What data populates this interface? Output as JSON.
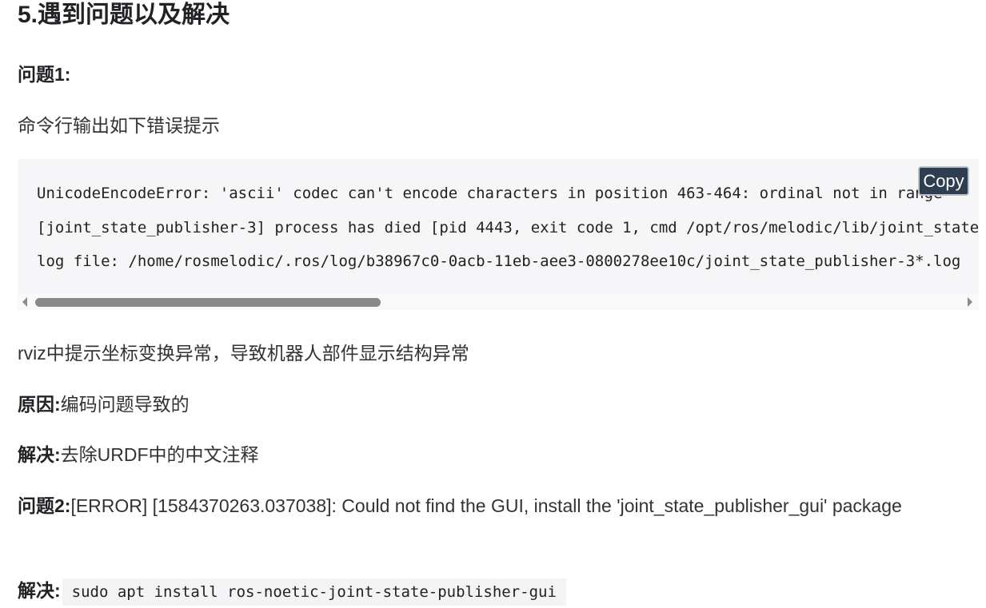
{
  "section_title": "5.遇到问题以及解决",
  "problem1": {
    "heading": "问题1:",
    "desc": "命令行输出如下错误提示",
    "code_lines": [
      "UnicodeEncodeError: 'ascii' codec can't encode characters in position 463-464: ordinal not in range",
      "[joint_state_publisher-3] process has died [pid 4443, exit code 1, cmd /opt/ros/melodic/lib/joint_state_publisher",
      "log file: /home/rosmelodic/.ros/log/b38967c0-0acb-11eb-aee3-0800278ee10c/joint_state_publisher-3*.log"
    ],
    "copy_label": "Copy",
    "rviz_note": "rviz中提示坐标变换异常，导致机器人部件显示结构异常",
    "cause_label": "原因:",
    "cause_text": "编码问题导致的",
    "solution_label": "解决:",
    "solution_text": "去除URDF中的中文注释"
  },
  "problem2": {
    "heading": "问题2:",
    "text": "[ERROR] [1584370263.037038]: Could not find the GUI, install the 'joint_state_publisher_gui' package",
    "solution_label": "解决:",
    "solution_code": "sudo apt install ros-noetic-joint-state-publisher-gui"
  }
}
